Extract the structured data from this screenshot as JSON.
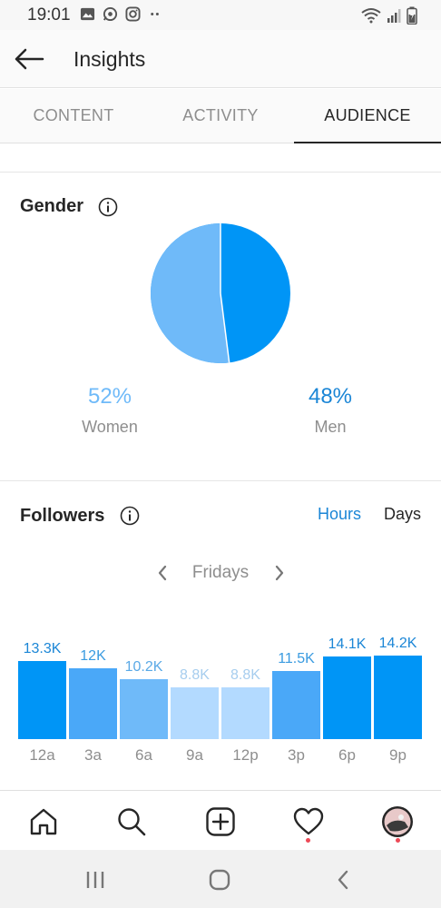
{
  "status_bar": {
    "time": "19:01",
    "left_icons": [
      "gallery-icon",
      "whatsapp-icon",
      "instagram-icon",
      "more-dots-icon"
    ],
    "right_icons": [
      "wifi-icon",
      "signal-icon",
      "battery-icon"
    ]
  },
  "header": {
    "title": "Insights"
  },
  "tabs": [
    {
      "label": "CONTENT",
      "active": false
    },
    {
      "label": "ACTIVITY",
      "active": false
    },
    {
      "label": "AUDIENCE",
      "active": true
    }
  ],
  "gender": {
    "title": "Gender",
    "women": {
      "percent": "52%",
      "label": "Women",
      "color": "#6fbaf9"
    },
    "men": {
      "percent": "48%",
      "label": "Men",
      "color": "#0095f6"
    }
  },
  "followers": {
    "title": "Followers",
    "toggle_hours": "Hours",
    "toggle_days": "Days",
    "day": "Fridays"
  },
  "chart_data": {
    "type": "bar",
    "categories": [
      "12a",
      "3a",
      "6a",
      "9a",
      "12p",
      "3p",
      "6p",
      "9p"
    ],
    "values": [
      13.3,
      12,
      10.2,
      8.8,
      8.8,
      11.5,
      14.1,
      14.2
    ],
    "value_labels": [
      "13.3K",
      "12K",
      "10.2K",
      "8.8K",
      "8.8K",
      "11.5K",
      "14.1K",
      "14.2K"
    ],
    "unit": "K",
    "bar_colors": [
      "#0095f6",
      "#4aa8f8",
      "#6fbaf9",
      "#b3daff",
      "#b3daff",
      "#4aa8f8",
      "#0095f6",
      "#0095f6"
    ],
    "label_colors": [
      "#1b86d6",
      "#3a9be0",
      "#5aa9e6",
      "#a6cdee",
      "#a6cdee",
      "#3a9be0",
      "#1b86d6",
      "#1b86d6"
    ]
  },
  "colors": {
    "accent": "#0095f6",
    "text_primary": "#262626",
    "text_secondary": "#8e8e8e",
    "notification_dot": "#ed4956"
  },
  "bottom_nav": [
    "home-icon",
    "search-icon",
    "add-post-icon",
    "activity-heart-icon",
    "profile-avatar"
  ]
}
